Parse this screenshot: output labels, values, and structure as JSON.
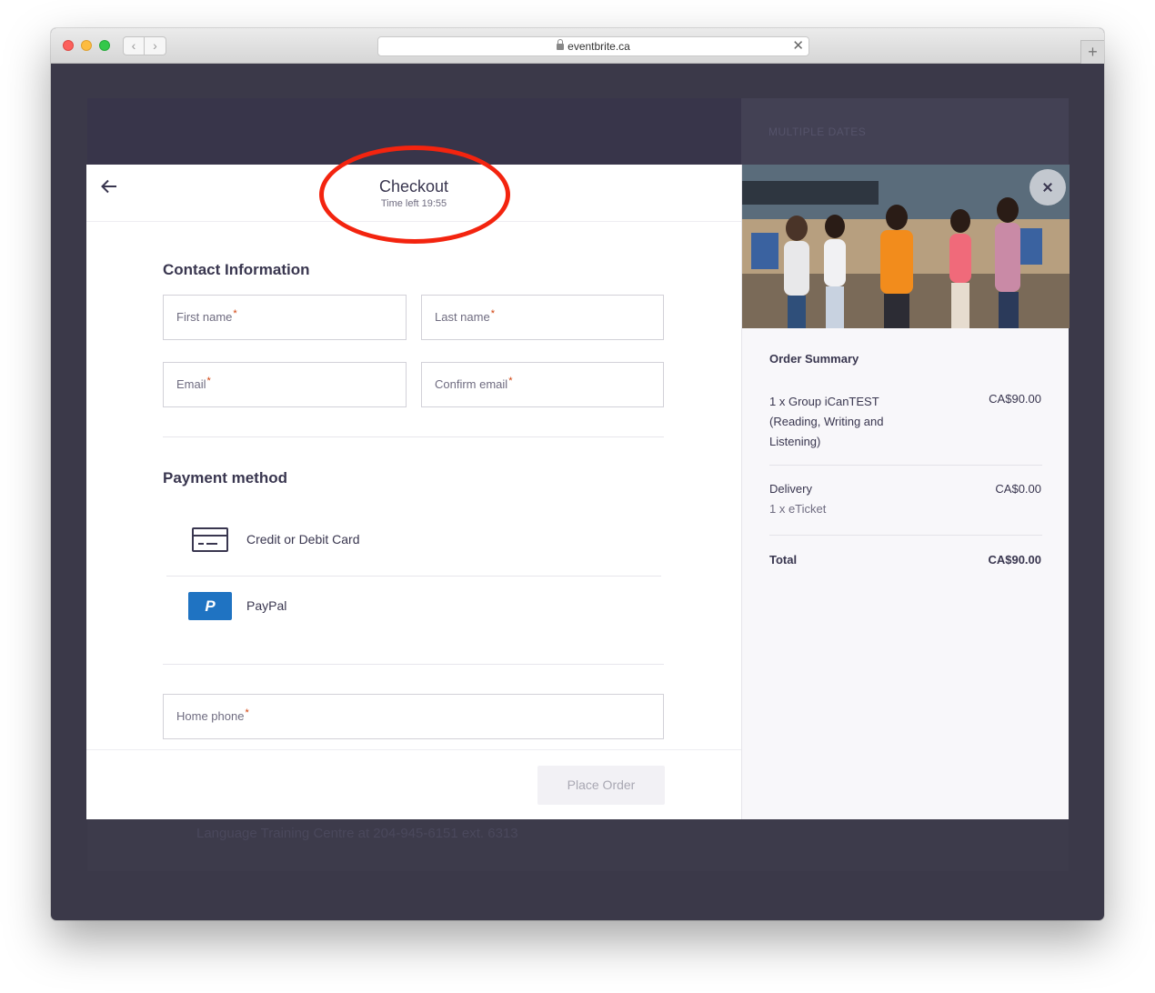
{
  "browser": {
    "url": "eventbrite.ca",
    "back_glyph": "‹",
    "forward_glyph": "›",
    "clear_glyph": "✕",
    "newtab_glyph": "+"
  },
  "background_page": {
    "side_label": "MULTIPLE DATES",
    "footer_text": "Language Training Centre at 204-945-6151 ext. 6313"
  },
  "checkout": {
    "title": "Checkout",
    "time_left": "Time left 19:55",
    "contact_title": "Contact Information",
    "fields": {
      "first_name": "First name",
      "last_name": "Last name",
      "email": "Email",
      "confirm_email": "Confirm email",
      "home_phone": "Home phone",
      "required_mark": "*"
    },
    "payment_title": "Payment method",
    "payment_options": [
      {
        "label": "Credit or Debit Card",
        "icon": "credit-card-icon"
      },
      {
        "label": "PayPal",
        "icon": "paypal-icon"
      }
    ],
    "paypal_glyph": "P",
    "place_order": "Place Order"
  },
  "order_summary": {
    "title": "Order Summary",
    "item": "1 x Group iCanTEST (Reading, Writing and Listening)",
    "item_price": "CA$90.00",
    "delivery_label": "Delivery",
    "delivery_sub": "1 x eTicket",
    "delivery_price": "CA$0.00",
    "total_label": "Total",
    "total_price": "CA$90.00"
  },
  "colors": {
    "annotation_ring": "#f3240f",
    "paypal_blue": "#1f73c2",
    "overlay": "#3b3949",
    "required": "#d1410c"
  }
}
